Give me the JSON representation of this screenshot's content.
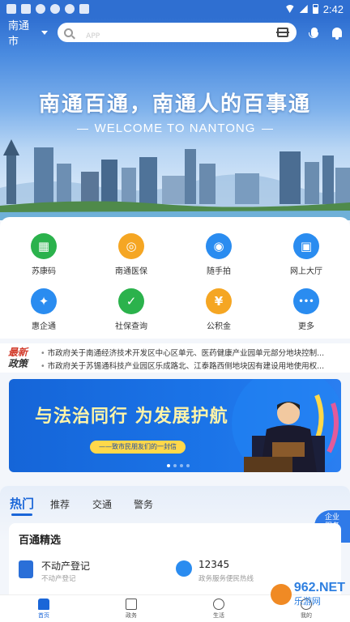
{
  "status_bar": {
    "time": "2:42"
  },
  "header": {
    "city": "南通市",
    "search_placeholder": "APP"
  },
  "hero": {
    "title": "南通百通，南通人的百事通",
    "subtitle": "WELCOME TO NANTONG"
  },
  "services": [
    {
      "label": "苏康码",
      "icon": "qr-code-icon",
      "color": "#2bb24c",
      "glyph": "▦"
    },
    {
      "label": "南通医保",
      "icon": "medical-insurance-icon",
      "color": "#f5a623",
      "glyph": "◎"
    },
    {
      "label": "随手拍",
      "icon": "camera-icon",
      "color": "#2a8cf0",
      "glyph": "◉"
    },
    {
      "label": "网上大厅",
      "icon": "online-hall-icon",
      "color": "#2a8cf0",
      "glyph": "▣"
    },
    {
      "label": "惠企通",
      "icon": "enterprise-icon",
      "color": "#2a8cf0",
      "glyph": "✦"
    },
    {
      "label": "社保查询",
      "icon": "social-security-icon",
      "color": "#2bb24c",
      "glyph": "✓"
    },
    {
      "label": "公积金",
      "icon": "housing-fund-icon",
      "color": "#f5a623",
      "glyph": "¥"
    },
    {
      "label": "更多",
      "icon": "more-icon",
      "color": "#2a8cf0",
      "glyph": "•••"
    }
  ],
  "news": {
    "badge_top": "最新",
    "badge_bottom": "政策",
    "items": [
      "市政府关于南通经济技术开发区中心区单元、医药健康产业园单元部分地块控制...",
      "市政府关于苏锡通科技产业园区乐成路北、江泰路西侧地块因有建设用地使用权..."
    ]
  },
  "banner": {
    "title": "与法治同行  为发展护航",
    "pill": "——致市民朋友们的一封信"
  },
  "tabs": [
    "热门",
    "推荐",
    "交通",
    "警务"
  ],
  "float_service": {
    "line1": "企业",
    "line2": "服务",
    "line3": "⇄"
  },
  "card": {
    "title": "百通精选",
    "items": [
      {
        "title": "不动产登记",
        "sub": "不动产登记"
      },
      {
        "title": "12345",
        "sub": "政务服务便民热线"
      }
    ]
  },
  "bottom_nav": [
    "首页",
    "政务",
    "生活",
    "我的"
  ],
  "watermark": {
    "text": "962.NET",
    "sub": "乐游网"
  }
}
